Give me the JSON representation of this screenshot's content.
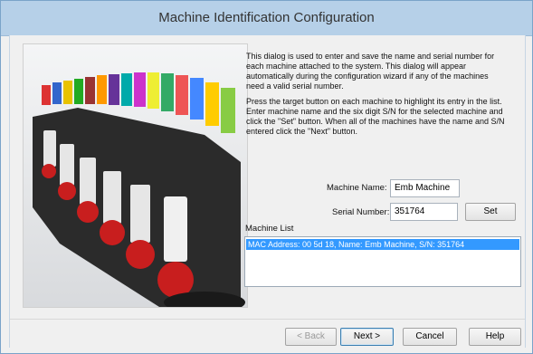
{
  "window": {
    "title": "Machine Identification Configuration"
  },
  "description": {
    "p1": "This dialog is used to enter and save the name and serial number for each machine attached to the system. This dialog will appear automatically during the configuration wizard if any of the machines need a valid serial number.",
    "p2": "Press the target button on each machine to highlight its entry in the list. Enter machine name and the six digit S/N for the selected machine and click the \"Set\" button. When all of the machines have the name and S/N entered click the \"Next\" button."
  },
  "form": {
    "machine_name_label": "Machine Name:",
    "machine_name_value": "Emb Machine",
    "serial_number_label": "Serial Number:",
    "serial_number_value": "351764",
    "set_label": "Set"
  },
  "machine_list": {
    "label": "Machine List",
    "items": [
      "MAC Address: 00 5d 18, Name: Emb Machine, S/N: 351764"
    ]
  },
  "buttons": {
    "back": "< Back",
    "next": "Next >",
    "cancel": "Cancel",
    "help": "Help"
  },
  "colors": {
    "titlebar": "#b6d0e8",
    "selection": "#3399ff"
  }
}
